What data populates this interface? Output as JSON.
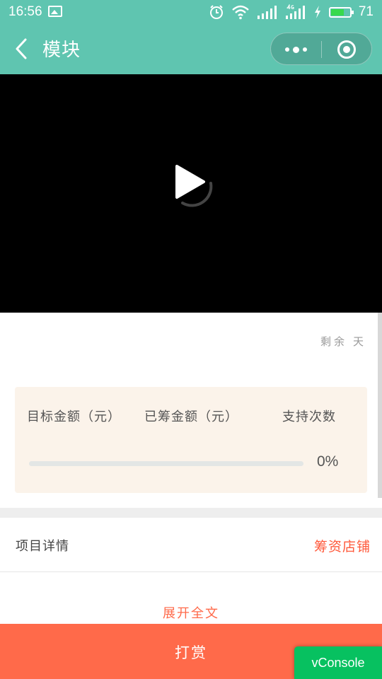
{
  "status_bar": {
    "time": "16:56",
    "battery_text": "71",
    "battery_level": 0.71,
    "icons": [
      "image-icon",
      "alarm-icon",
      "wifi-icon",
      "signal-icon",
      "signal-4g-icon",
      "charging-icon",
      "battery-icon"
    ]
  },
  "nav": {
    "title": "模块",
    "back_icon": "chevron-left-icon",
    "more_icon": "more-dots-icon",
    "close_icon": "target-circle-icon",
    "bg_color": "#5fc5b0"
  },
  "video": {
    "play_icon": "play-icon",
    "loading_icon": "loading-spinner-icon"
  },
  "project": {
    "remaining_prefix": "剩余",
    "remaining_days": "",
    "remaining_suffix": "天"
  },
  "funding": {
    "target_label": "目标金额（元）",
    "raised_label": "已筹金额（元）",
    "support_label": "支持次数",
    "progress": 0,
    "progress_text": "0%"
  },
  "details": {
    "title": "项目详情",
    "shop_link": "筹资店铺",
    "expand_label": "展开全文"
  },
  "actions": {
    "reward_label": "打赏",
    "accent_color": "#ff6a4a"
  },
  "debug": {
    "vconsole_label": "vConsole"
  }
}
